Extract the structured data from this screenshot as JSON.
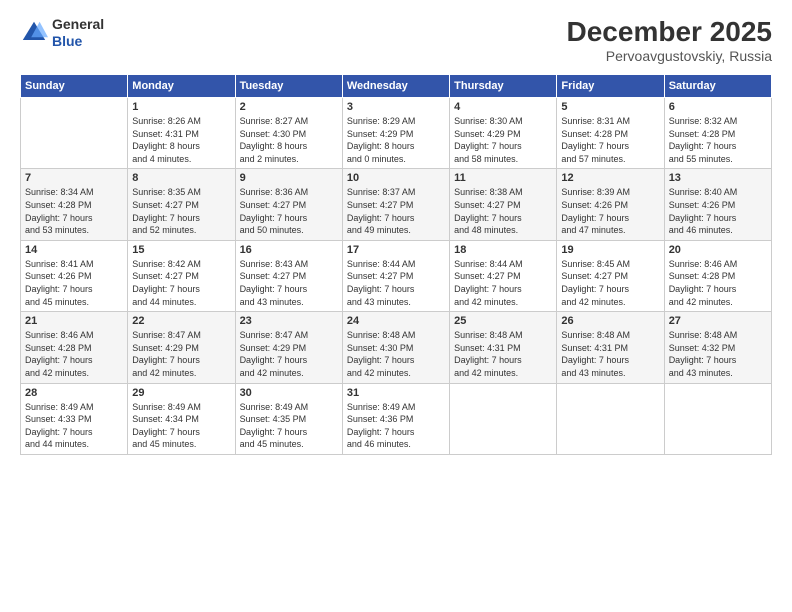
{
  "header": {
    "logo": {
      "general": "General",
      "blue": "Blue"
    },
    "title": "December 2025",
    "location": "Pervoavgustovskiy, Russia"
  },
  "weekdays": [
    "Sunday",
    "Monday",
    "Tuesday",
    "Wednesday",
    "Thursday",
    "Friday",
    "Saturday"
  ],
  "weeks": [
    [
      {
        "day": null,
        "detail": null
      },
      {
        "day": "1",
        "detail": "Sunrise: 8:26 AM\nSunset: 4:31 PM\nDaylight: 8 hours\nand 4 minutes."
      },
      {
        "day": "2",
        "detail": "Sunrise: 8:27 AM\nSunset: 4:30 PM\nDaylight: 8 hours\nand 2 minutes."
      },
      {
        "day": "3",
        "detail": "Sunrise: 8:29 AM\nSunset: 4:29 PM\nDaylight: 8 hours\nand 0 minutes."
      },
      {
        "day": "4",
        "detail": "Sunrise: 8:30 AM\nSunset: 4:29 PM\nDaylight: 7 hours\nand 58 minutes."
      },
      {
        "day": "5",
        "detail": "Sunrise: 8:31 AM\nSunset: 4:28 PM\nDaylight: 7 hours\nand 57 minutes."
      },
      {
        "day": "6",
        "detail": "Sunrise: 8:32 AM\nSunset: 4:28 PM\nDaylight: 7 hours\nand 55 minutes."
      }
    ],
    [
      {
        "day": "7",
        "detail": "Sunrise: 8:34 AM\nSunset: 4:28 PM\nDaylight: 7 hours\nand 53 minutes."
      },
      {
        "day": "8",
        "detail": "Sunrise: 8:35 AM\nSunset: 4:27 PM\nDaylight: 7 hours\nand 52 minutes."
      },
      {
        "day": "9",
        "detail": "Sunrise: 8:36 AM\nSunset: 4:27 PM\nDaylight: 7 hours\nand 50 minutes."
      },
      {
        "day": "10",
        "detail": "Sunrise: 8:37 AM\nSunset: 4:27 PM\nDaylight: 7 hours\nand 49 minutes."
      },
      {
        "day": "11",
        "detail": "Sunrise: 8:38 AM\nSunset: 4:27 PM\nDaylight: 7 hours\nand 48 minutes."
      },
      {
        "day": "12",
        "detail": "Sunrise: 8:39 AM\nSunset: 4:26 PM\nDaylight: 7 hours\nand 47 minutes."
      },
      {
        "day": "13",
        "detail": "Sunrise: 8:40 AM\nSunset: 4:26 PM\nDaylight: 7 hours\nand 46 minutes."
      }
    ],
    [
      {
        "day": "14",
        "detail": "Sunrise: 8:41 AM\nSunset: 4:26 PM\nDaylight: 7 hours\nand 45 minutes."
      },
      {
        "day": "15",
        "detail": "Sunrise: 8:42 AM\nSunset: 4:27 PM\nDaylight: 7 hours\nand 44 minutes."
      },
      {
        "day": "16",
        "detail": "Sunrise: 8:43 AM\nSunset: 4:27 PM\nDaylight: 7 hours\nand 43 minutes."
      },
      {
        "day": "17",
        "detail": "Sunrise: 8:44 AM\nSunset: 4:27 PM\nDaylight: 7 hours\nand 43 minutes."
      },
      {
        "day": "18",
        "detail": "Sunrise: 8:44 AM\nSunset: 4:27 PM\nDaylight: 7 hours\nand 42 minutes."
      },
      {
        "day": "19",
        "detail": "Sunrise: 8:45 AM\nSunset: 4:27 PM\nDaylight: 7 hours\nand 42 minutes."
      },
      {
        "day": "20",
        "detail": "Sunrise: 8:46 AM\nSunset: 4:28 PM\nDaylight: 7 hours\nand 42 minutes."
      }
    ],
    [
      {
        "day": "21",
        "detail": "Sunrise: 8:46 AM\nSunset: 4:28 PM\nDaylight: 7 hours\nand 42 minutes."
      },
      {
        "day": "22",
        "detail": "Sunrise: 8:47 AM\nSunset: 4:29 PM\nDaylight: 7 hours\nand 42 minutes."
      },
      {
        "day": "23",
        "detail": "Sunrise: 8:47 AM\nSunset: 4:29 PM\nDaylight: 7 hours\nand 42 minutes."
      },
      {
        "day": "24",
        "detail": "Sunrise: 8:48 AM\nSunset: 4:30 PM\nDaylight: 7 hours\nand 42 minutes."
      },
      {
        "day": "25",
        "detail": "Sunrise: 8:48 AM\nSunset: 4:31 PM\nDaylight: 7 hours\nand 42 minutes."
      },
      {
        "day": "26",
        "detail": "Sunrise: 8:48 AM\nSunset: 4:31 PM\nDaylight: 7 hours\nand 43 minutes."
      },
      {
        "day": "27",
        "detail": "Sunrise: 8:48 AM\nSunset: 4:32 PM\nDaylight: 7 hours\nand 43 minutes."
      }
    ],
    [
      {
        "day": "28",
        "detail": "Sunrise: 8:49 AM\nSunset: 4:33 PM\nDaylight: 7 hours\nand 44 minutes."
      },
      {
        "day": "29",
        "detail": "Sunrise: 8:49 AM\nSunset: 4:34 PM\nDaylight: 7 hours\nand 45 minutes."
      },
      {
        "day": "30",
        "detail": "Sunrise: 8:49 AM\nSunset: 4:35 PM\nDaylight: 7 hours\nand 45 minutes."
      },
      {
        "day": "31",
        "detail": "Sunrise: 8:49 AM\nSunset: 4:36 PM\nDaylight: 7 hours\nand 46 minutes."
      },
      {
        "day": null,
        "detail": null
      },
      {
        "day": null,
        "detail": null
      },
      {
        "day": null,
        "detail": null
      }
    ]
  ]
}
